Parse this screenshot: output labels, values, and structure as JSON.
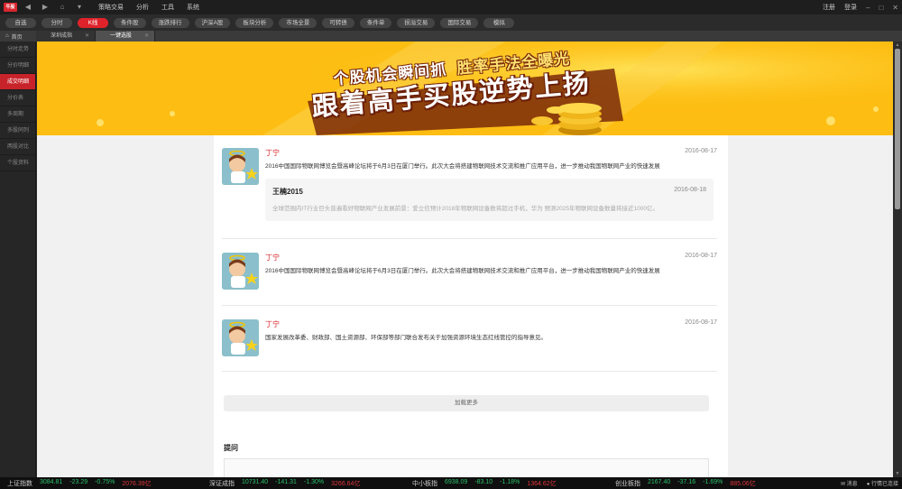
{
  "app": {
    "logo": "牛股",
    "menu": [
      "策略交易",
      "分析",
      "工具",
      "系统"
    ],
    "window_controls": [
      "注册",
      "登录"
    ]
  },
  "funcbar": {
    "tabs": [
      "自选",
      "分时",
      "K线",
      "条件股",
      "涨跌排行",
      "沪深A股",
      "板块分析",
      "市场全景",
      "可转债",
      "条件单",
      "损溢交易",
      "国际交易",
      "模拟"
    ],
    "active": "K线"
  },
  "tabbar": {
    "home": "首页",
    "tabs": [
      {
        "label": "深圳成指",
        "active": false
      },
      {
        "label": "一键选股",
        "active": true
      }
    ]
  },
  "sidebar": {
    "items": [
      "分时走势",
      "分价明细",
      "成交明细",
      "分价表",
      "多周期",
      "多股同列",
      "两股对比",
      "个股资料"
    ],
    "active_index": 2
  },
  "banner": {
    "line1_a": "个股机会瞬间抓",
    "line1_b": "胜率手法全曝光",
    "line2": "跟着高手买股逆势上扬"
  },
  "posts": [
    {
      "author": "丁宁",
      "date": "2016-08-17",
      "text": "2016中国国际物联网博览会暨高峰论坛将于6月3日在厦门举行。此次大会将搭建物联网技术交流和推广应用平台，进一步推动我国物联网产业的快速发展",
      "reply": {
        "author": "王楠2015",
        "date": "2016-08-18",
        "text": "全球范围内IT行业巨头普遍看好物联网产业发展前景：爱立信预计2018年物联网设备数将超过手机，华为 预测2025年物联网设备数量将接近1000亿。"
      }
    },
    {
      "author": "丁宁",
      "date": "2016-08-17",
      "text": "2016中国国际物联网博览会暨高峰论坛将于6月3日在厦门举行。此次大会将搭建物联网技术交流和推广应用平台，进一步推动我国物联网产业的快速发展"
    },
    {
      "author": "丁宁",
      "date": "2016-08-17",
      "text": "国家发展改革委、财政部、国土资源部、环保部等部门联合发布关于加强资源环境生态红线管控的指导意见。"
    }
  ],
  "load_more": "加载更多",
  "qa_title": "提问",
  "ticker": {
    "items": [
      {
        "name": "上证指数",
        "price": "3084.81",
        "change": "-23.29",
        "pct": "-0.75%",
        "amount": "2076.39亿"
      },
      {
        "name": "深证成指",
        "price": "10731.40",
        "change": "-141.31",
        "pct": "-1.30%",
        "amount": "3266.64亿"
      },
      {
        "name": "中小板指",
        "price": "6938.09",
        "change": "-83.10",
        "pct": "-1.18%",
        "amount": "1364.62亿"
      },
      {
        "name": "创业板指",
        "price": "2167.40",
        "change": "-37.16",
        "pct": "-1.69%",
        "amount": "885.06亿"
      }
    ],
    "msg": "消息",
    "status": "行情已连接"
  },
  "colors": {
    "accent": "#e0232b",
    "banner_bg": "#fdbd12",
    "down": "#29c06a"
  }
}
